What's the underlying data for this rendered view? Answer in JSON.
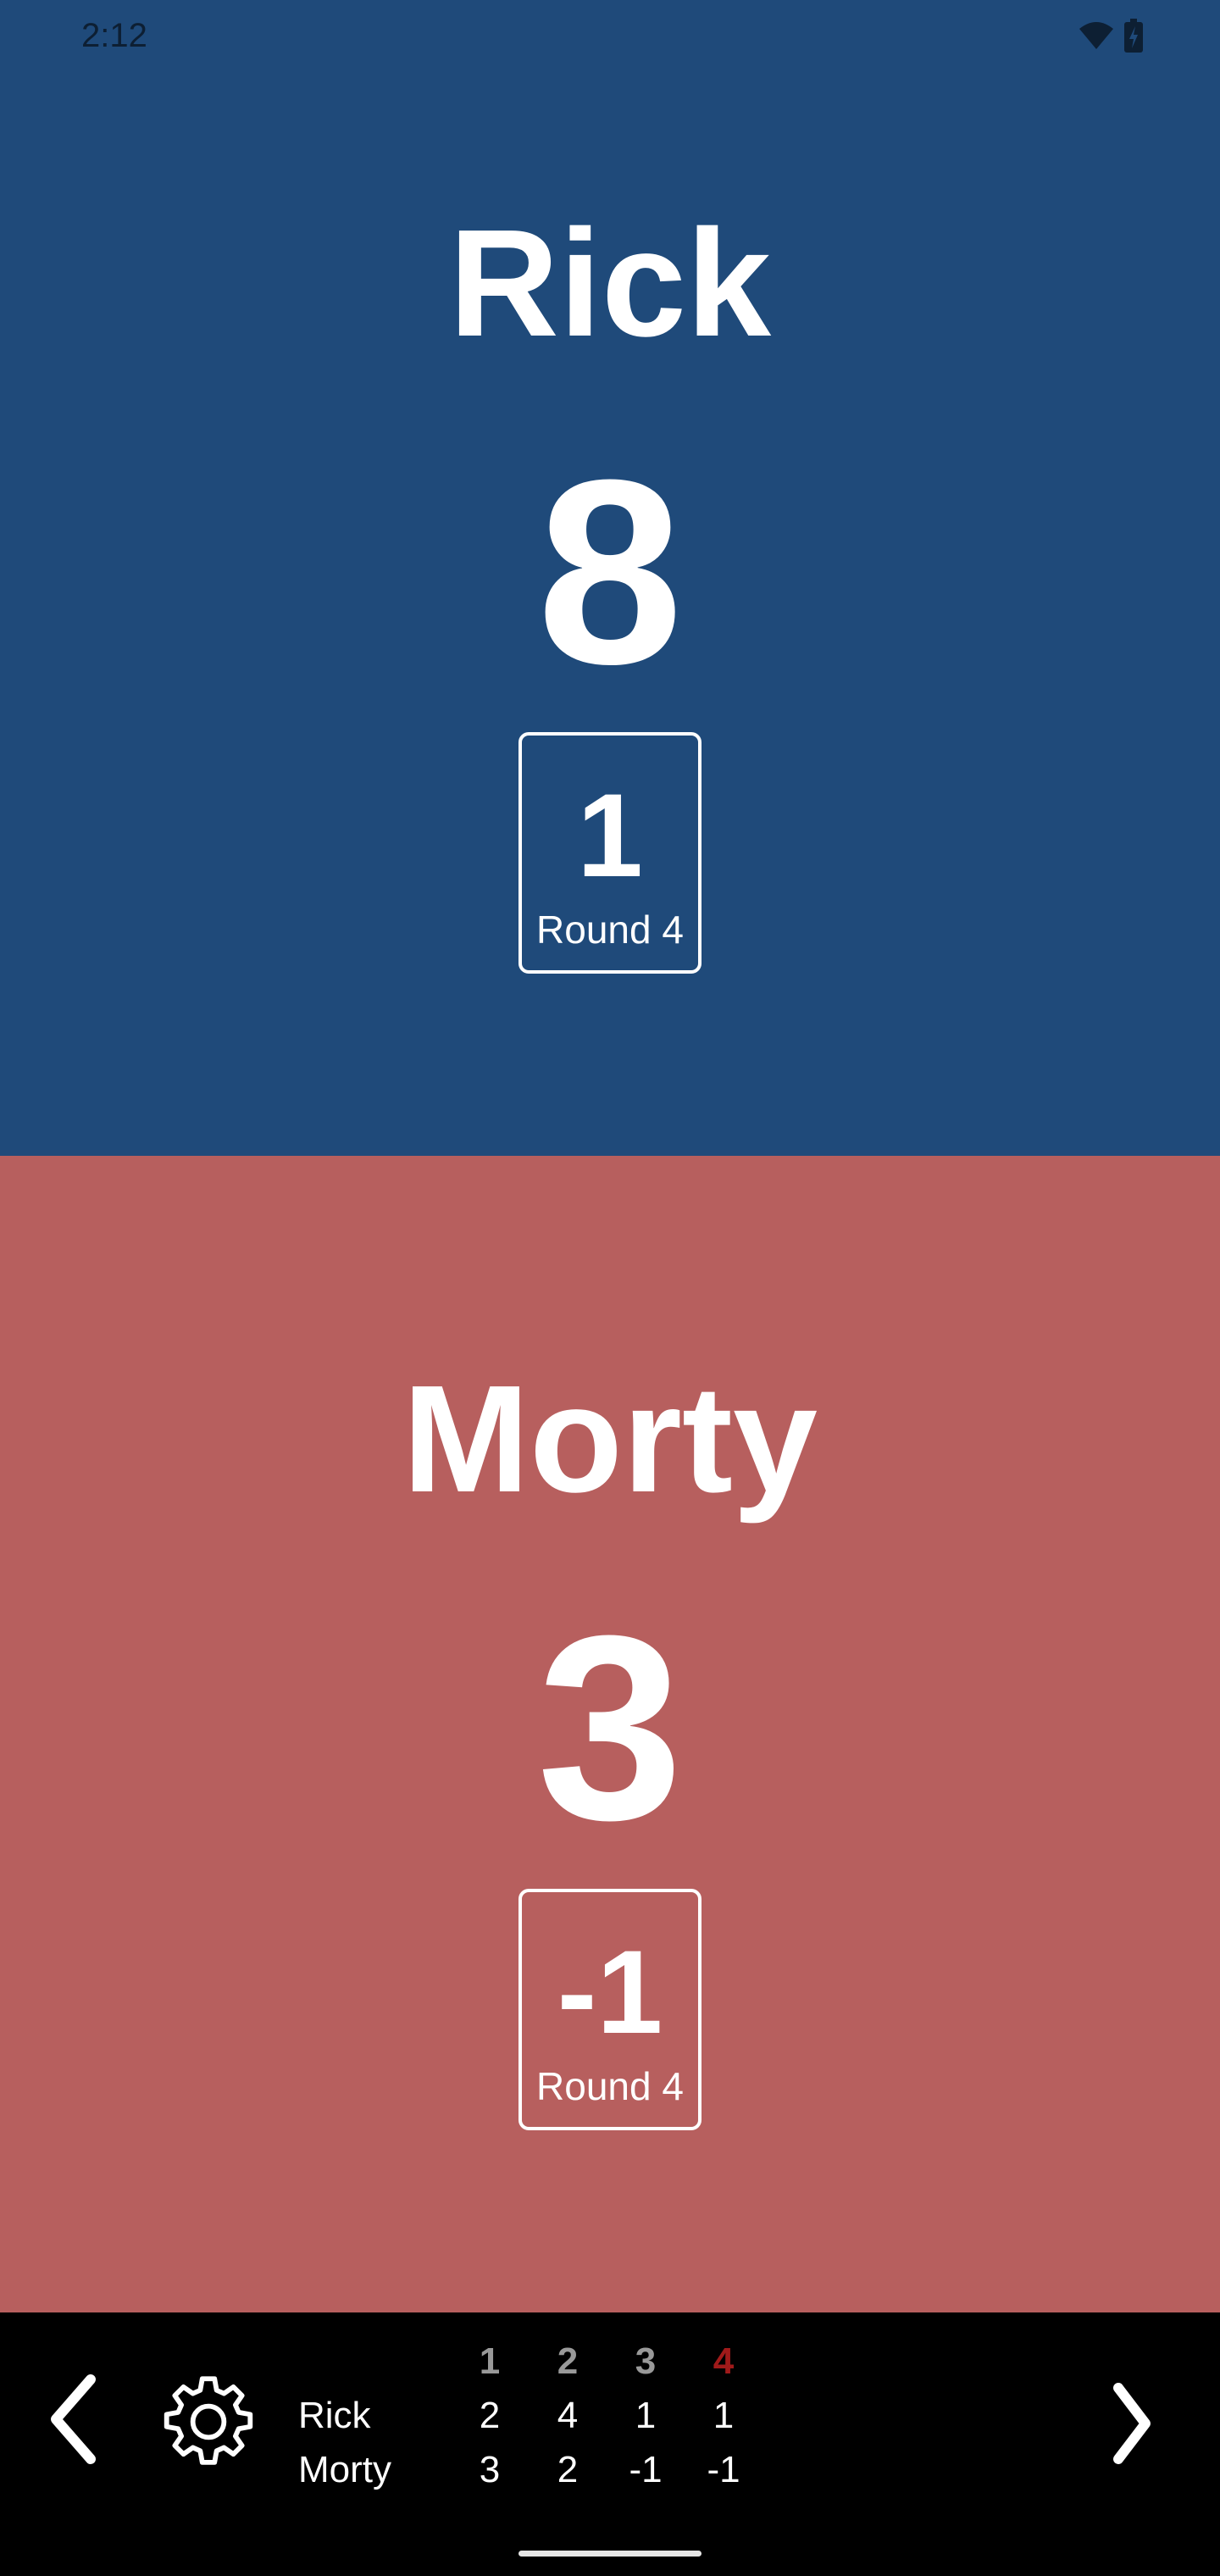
{
  "status_bar": {
    "time": "2:12",
    "icons": [
      "wifi-icon",
      "battery-charging-icon"
    ]
  },
  "colors": {
    "player1": "#1f4a7a",
    "player2": "#b75f5e",
    "current_round": "#a01a1a",
    "past_round": "#999999"
  },
  "players": [
    {
      "name": "Rick",
      "score": "8",
      "round_delta": "1",
      "round_label": "Round 4"
    },
    {
      "name": "Morty",
      "score": "3",
      "round_delta": "-1",
      "round_label": "Round 4"
    }
  ],
  "history": {
    "rounds": [
      "1",
      "2",
      "3",
      "4"
    ],
    "rows": [
      {
        "name": "Rick",
        "values": [
          "2",
          "4",
          "1",
          "1"
        ]
      },
      {
        "name": "Morty",
        "values": [
          "3",
          "2",
          "-1",
          "-1"
        ]
      }
    ]
  }
}
